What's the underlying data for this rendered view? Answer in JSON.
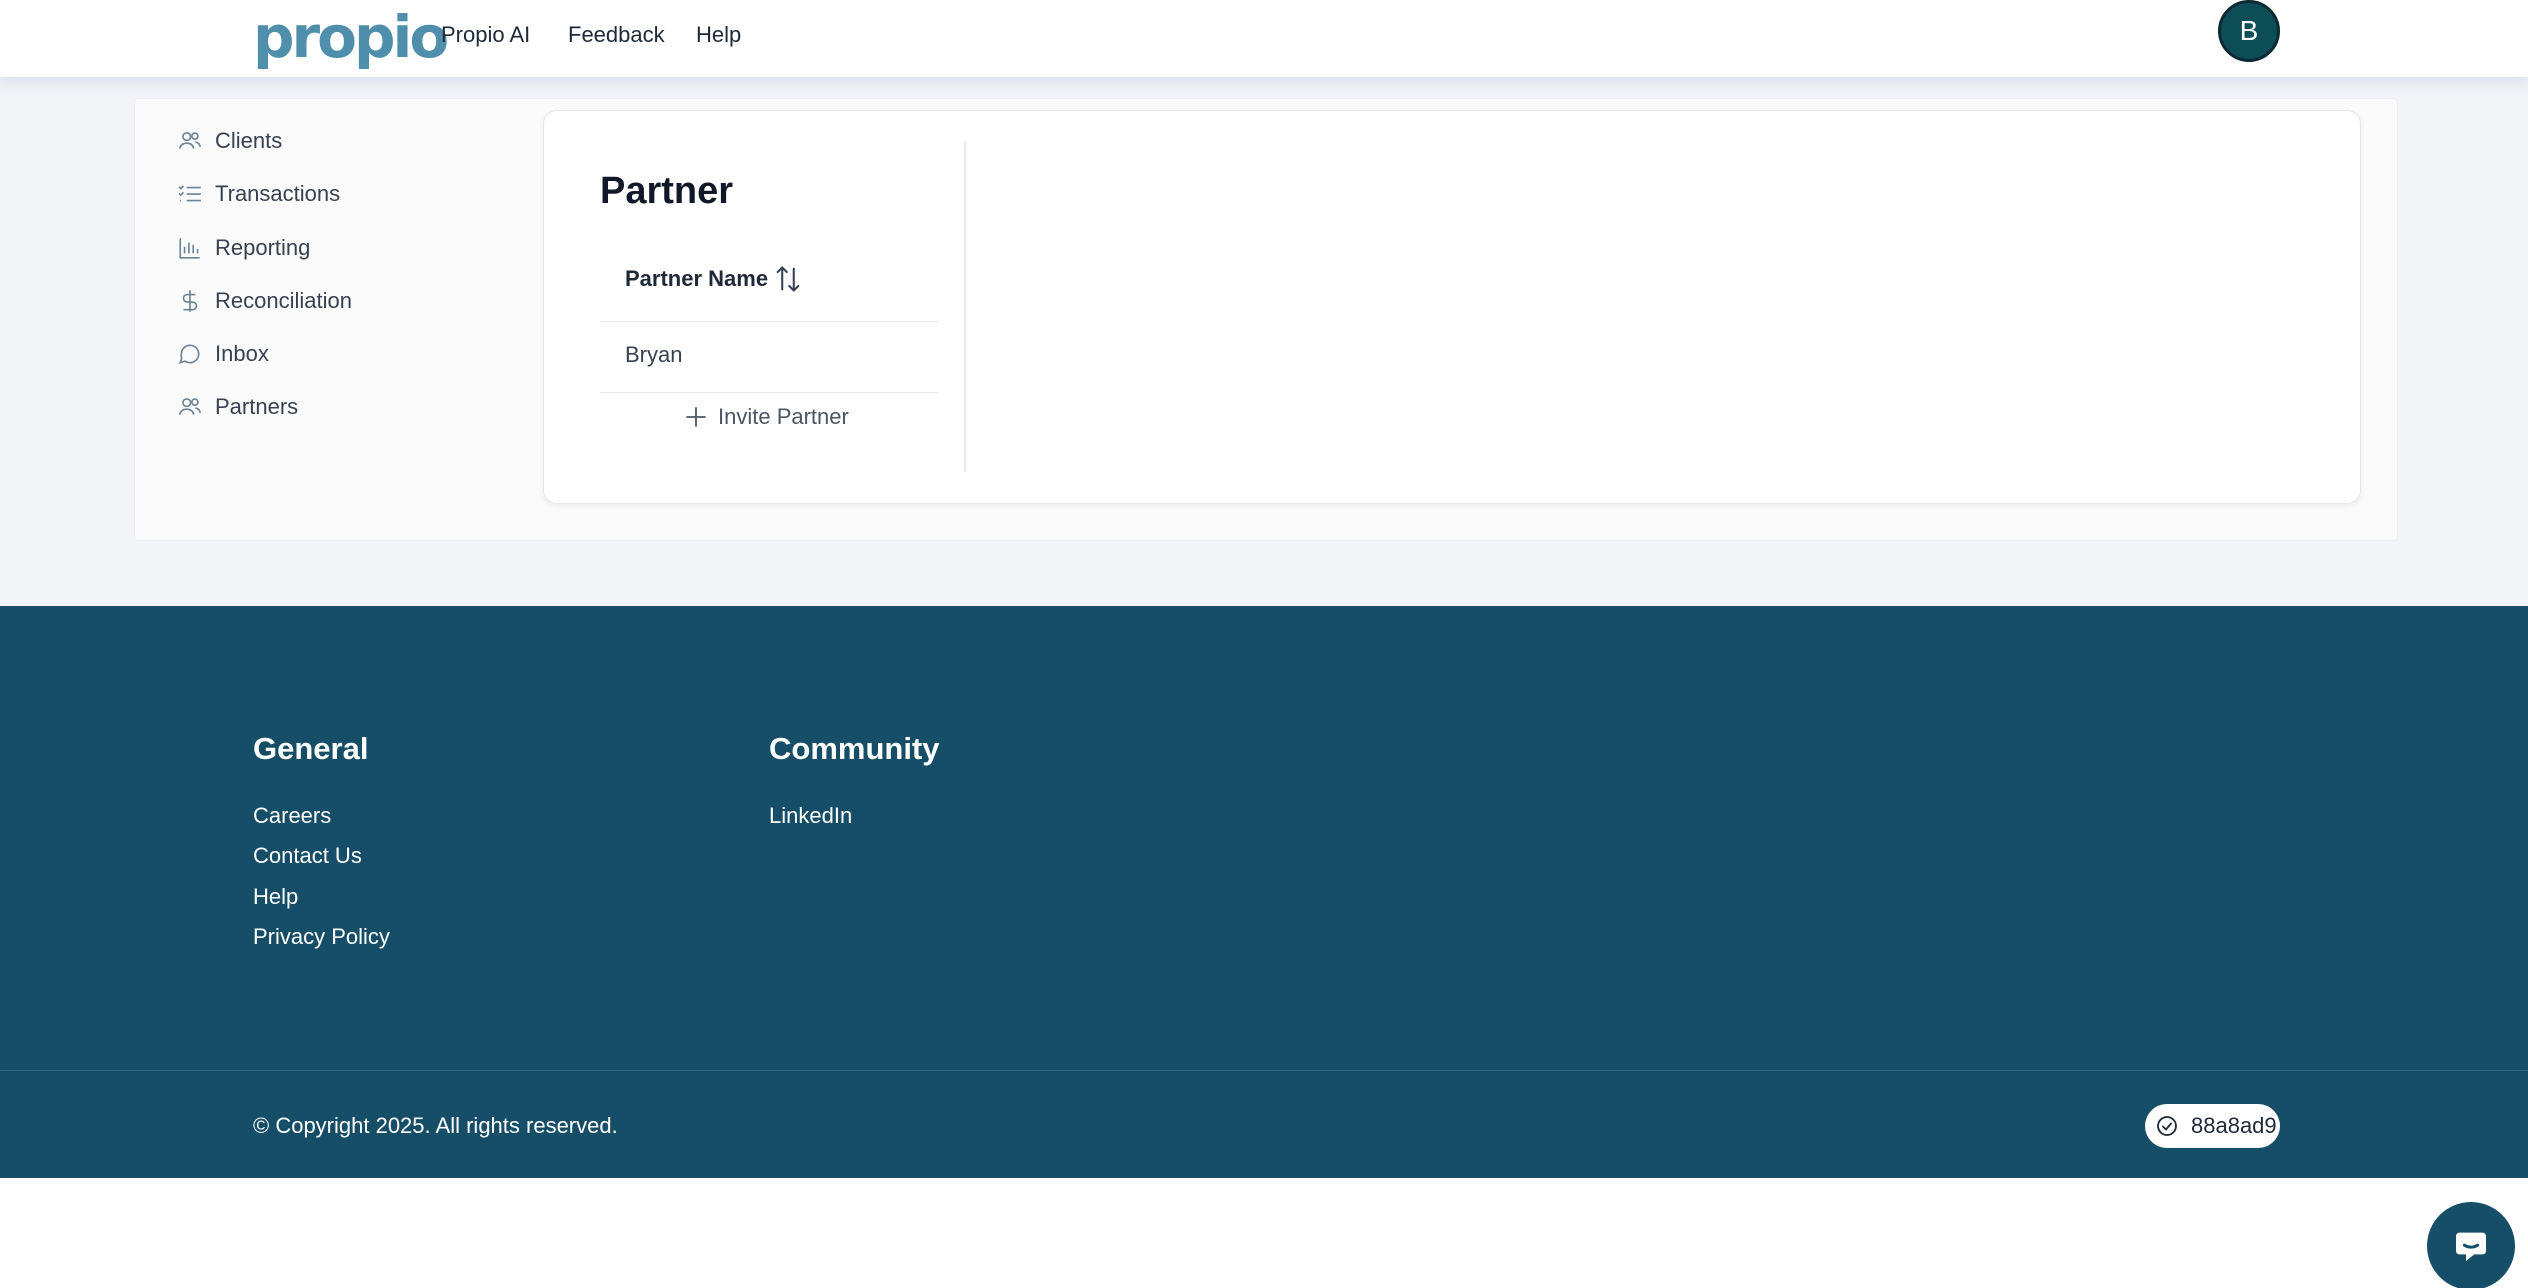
{
  "header": {
    "logo_text": "propio",
    "nav": [
      "Propio AI",
      "Feedback",
      "Help"
    ],
    "avatar_initial": "B"
  },
  "sidebar": {
    "items": [
      {
        "label": "Clients",
        "icon": "users-icon"
      },
      {
        "label": "Transactions",
        "icon": "list-icon"
      },
      {
        "label": "Reporting",
        "icon": "bar-chart-icon"
      },
      {
        "label": "Reconciliation",
        "icon": "dollar-icon"
      },
      {
        "label": "Inbox",
        "icon": "chat-bubble-icon"
      },
      {
        "label": "Partners",
        "icon": "users-icon"
      }
    ]
  },
  "main": {
    "title": "Partner",
    "column_header": "Partner Name",
    "rows": [
      "Bryan"
    ],
    "invite_label": "Invite Partner"
  },
  "footer": {
    "general_heading": "General",
    "general_links": [
      "Careers",
      "Contact Us",
      "Help",
      "Privacy Policy"
    ],
    "community_heading": "Community",
    "community_links": [
      "LinkedIn"
    ],
    "copyright": "© Copyright 2025. All rights reserved.",
    "version": "88a8ad9"
  },
  "colors": {
    "footer_bg": "#164e68",
    "logo": "#4f8fab",
    "avatar_bg": "#0d4d55"
  }
}
